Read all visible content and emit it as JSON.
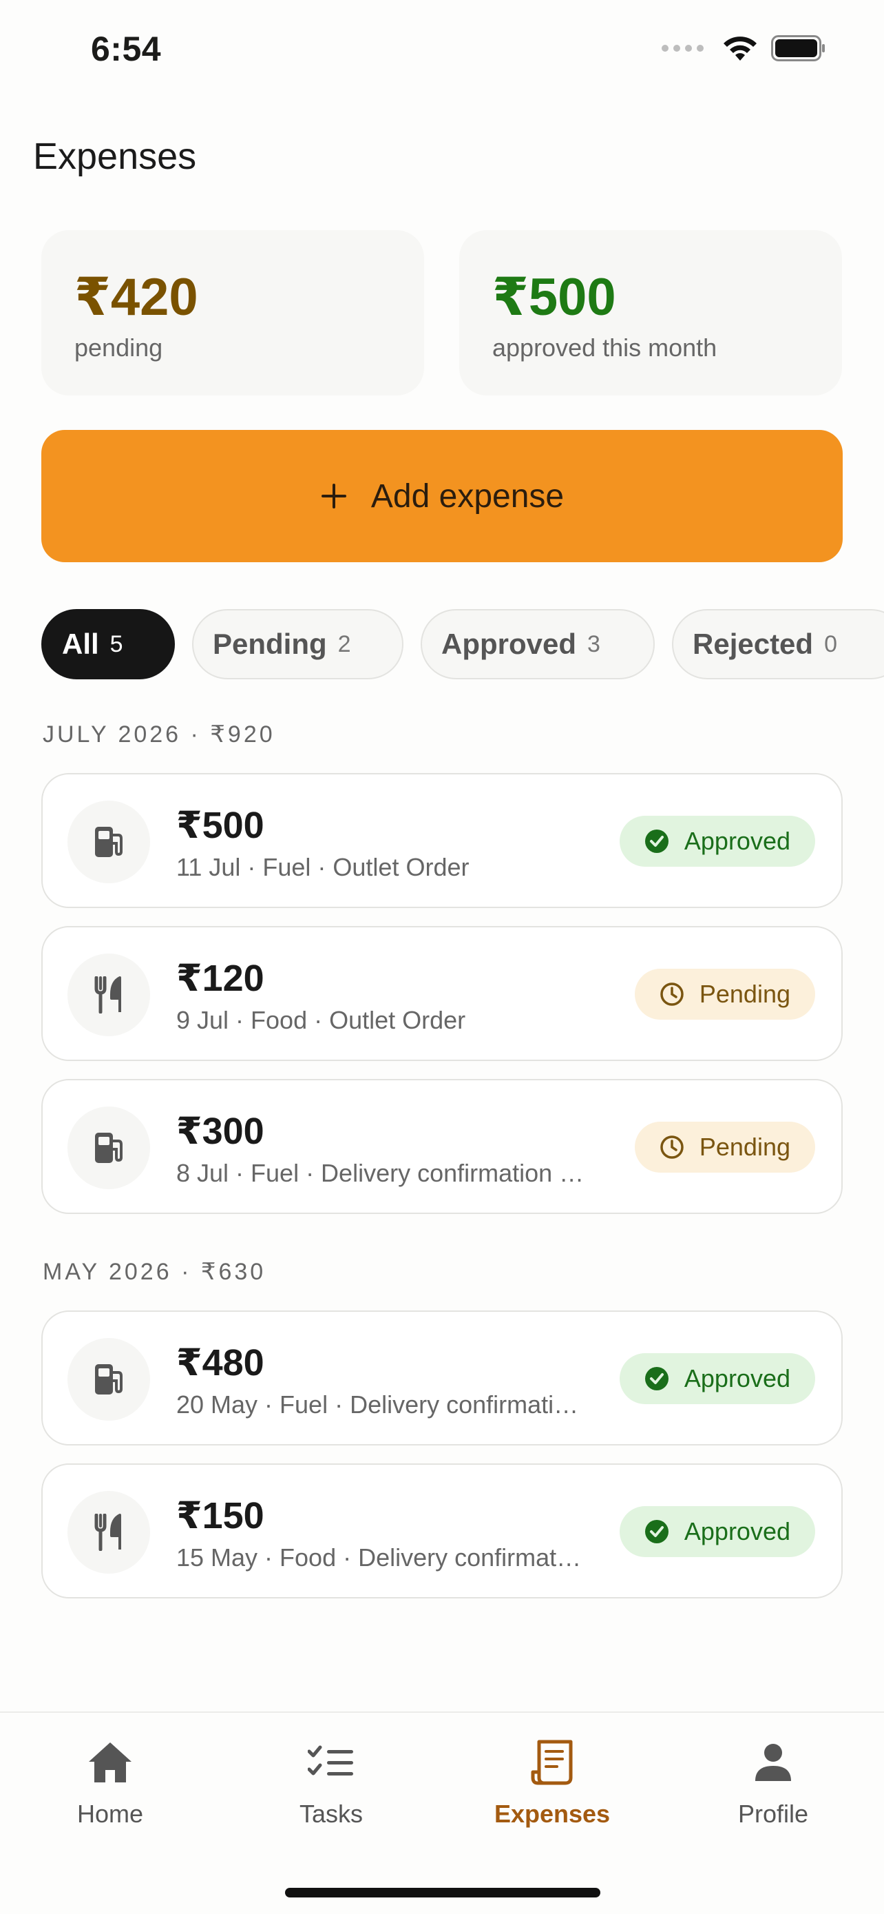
{
  "status_bar": {
    "time": "6:54"
  },
  "page": {
    "title": "Expenses"
  },
  "summary": {
    "pending": {
      "amount": "₹420",
      "label": "pending",
      "color": "#7a5200"
    },
    "approved": {
      "amount": "₹500",
      "label": "approved this month",
      "color": "#1e7a14"
    }
  },
  "add_button": {
    "icon": "plus-icon",
    "label": "Add expense",
    "color": "#f39320"
  },
  "filters": [
    {
      "label": "All",
      "count": "5",
      "active": true
    },
    {
      "label": "Pending",
      "count": "2",
      "active": false
    },
    {
      "label": "Approved",
      "count": "3",
      "active": false
    },
    {
      "label": "Rejected",
      "count": "0",
      "active": false
    }
  ],
  "sections": [
    {
      "header": "JULY 2026 · ₹920",
      "items": [
        {
          "amount": "₹500",
          "meta": "11 Jul · Fuel · Outlet Order",
          "category_icon": "fuel-icon",
          "status": "Approved"
        },
        {
          "amount": "₹120",
          "meta": "9 Jul · Food · Outlet Order",
          "category_icon": "food-icon",
          "status": "Pending"
        },
        {
          "amount": "₹300",
          "meta": "8 Jul · Fuel · Delivery confirmation …",
          "category_icon": "fuel-icon",
          "status": "Pending"
        }
      ]
    },
    {
      "header": "MAY 2026 · ₹630",
      "items": [
        {
          "amount": "₹480",
          "meta": "20 May · Fuel · Delivery confirmati…",
          "category_icon": "fuel-icon",
          "status": "Approved"
        },
        {
          "amount": "₹150",
          "meta": "15 May · Food · Delivery confirmat…",
          "category_icon": "food-icon",
          "status": "Approved"
        }
      ]
    }
  ],
  "bottom_nav": [
    {
      "label": "Home",
      "icon": "home-icon",
      "active": false
    },
    {
      "label": "Tasks",
      "icon": "tasks-icon",
      "active": false
    },
    {
      "label": "Expenses",
      "icon": "receipt-icon",
      "active": true
    },
    {
      "label": "Profile",
      "icon": "person-icon",
      "active": false
    }
  ],
  "colors": {
    "accent": "#f39320",
    "active_nav": "#a35a10",
    "approved": "#1a6e1a",
    "pending": "#7a5510"
  }
}
